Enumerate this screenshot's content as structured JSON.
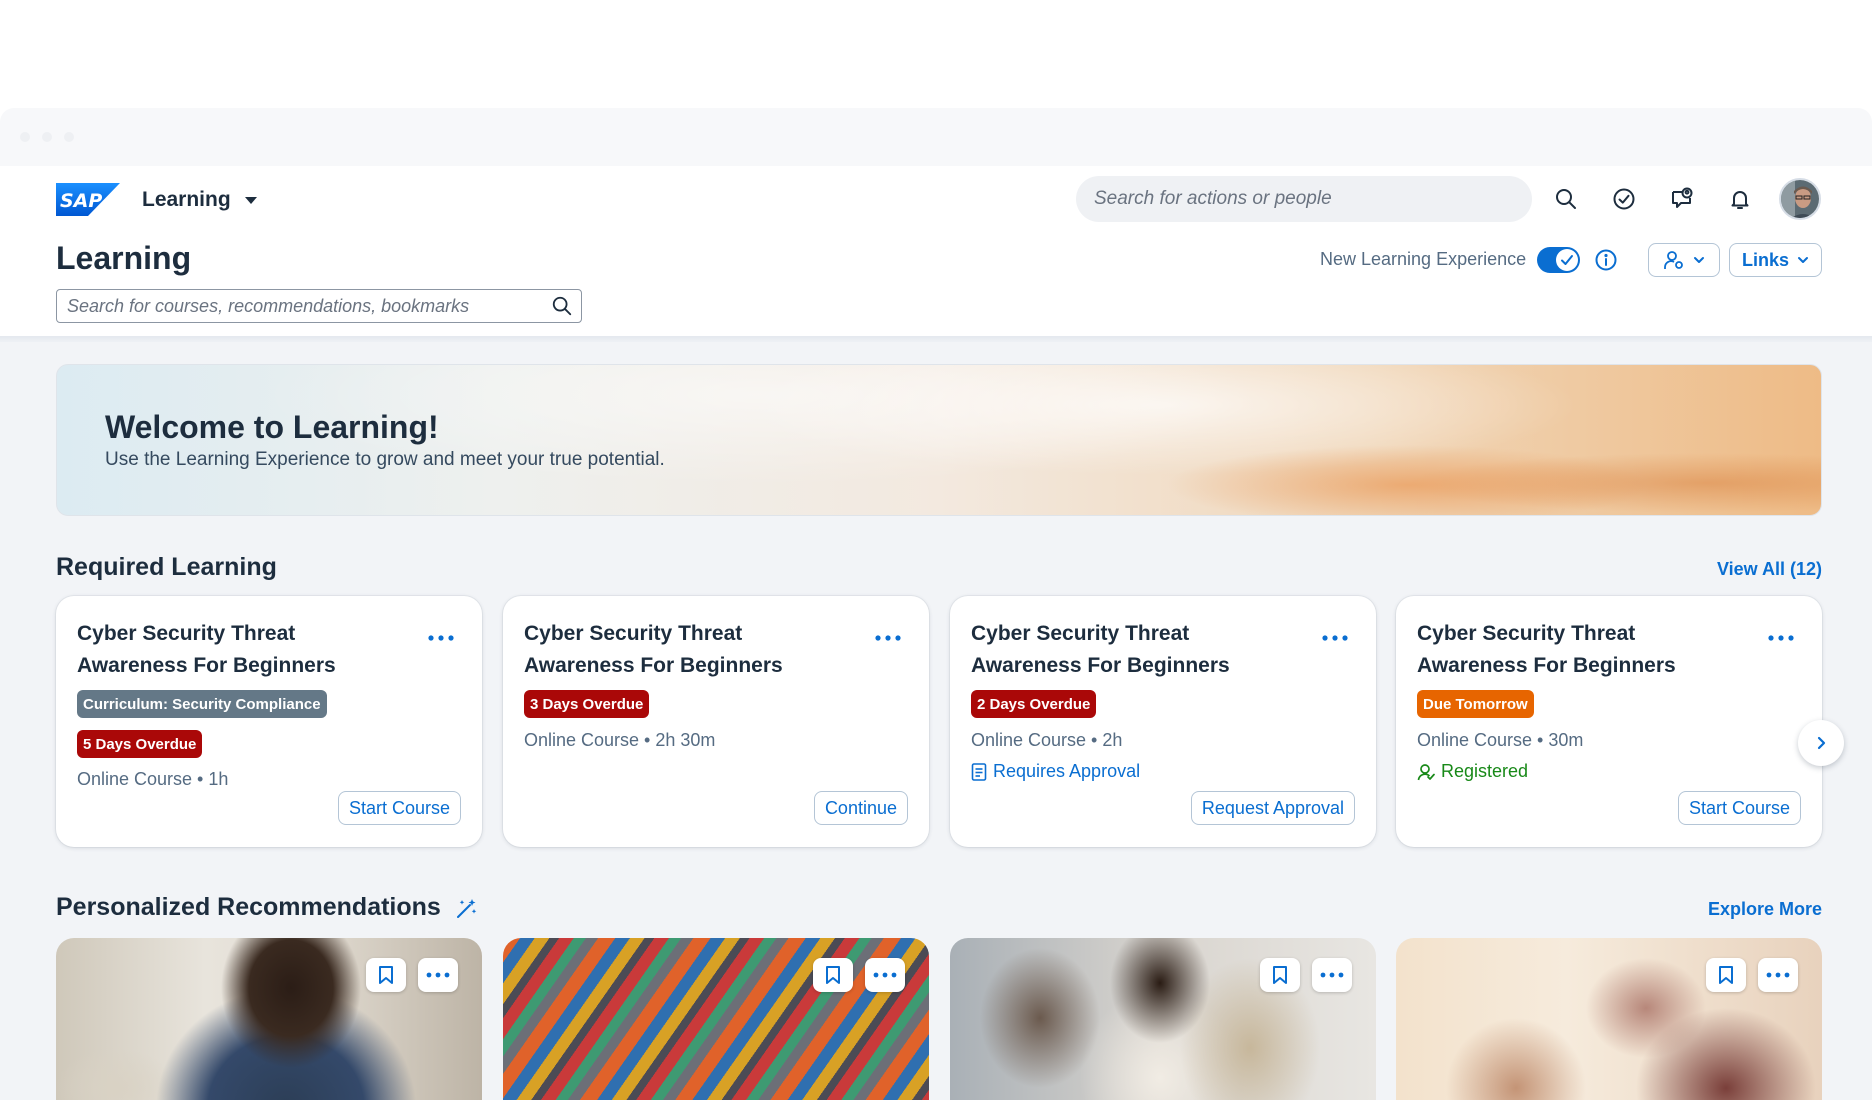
{
  "shell": {
    "logo_text": "SAP",
    "app_name": "Learning",
    "search_placeholder": "Search for actions or people"
  },
  "page": {
    "title": "Learning",
    "search_placeholder": "Search for courses, recommendations, bookmarks",
    "new_experience_label": "New Learning Experience",
    "new_experience_enabled": true,
    "links_label": "Links"
  },
  "banner": {
    "title": "Welcome to Learning!",
    "subtitle": "Use the Learning Experience to grow and meet your true potential."
  },
  "required": {
    "title": "Required Learning",
    "view_all": "View All (12)",
    "cards": [
      {
        "title": "Cyber Security Threat Awareness For Beginners",
        "curriculum_tag": "Curriculum: Security Compliance",
        "due_tag": "5 Days Overdue",
        "meta": "Online Course • 1h",
        "status": "",
        "action": "Start Course"
      },
      {
        "title": "Cyber Security Threat Awareness For Beginners",
        "curriculum_tag": "",
        "due_tag": "3 Days Overdue",
        "meta": "Online Course • 2h 30m",
        "status": "",
        "action": "Continue"
      },
      {
        "title": "Cyber Security Threat Awareness For Beginners",
        "curriculum_tag": "",
        "due_tag": "2 Days Overdue",
        "meta": "Online Course • 2h",
        "status": "Requires Approval",
        "action": "Request Approval"
      },
      {
        "title": "Cyber Security Threat Awareness For Beginners",
        "curriculum_tag": "",
        "due_tag": "Due Tomorrow",
        "meta": "Online Course • 30m",
        "status": "Registered",
        "action": "Start Course"
      }
    ]
  },
  "recommendations": {
    "title": "Personalized Recommendations",
    "explore": "Explore More"
  },
  "colors": {
    "accent": "#0a6ed1",
    "overdue": "#aa0808",
    "due_soon": "#e76500",
    "curriculum": "#647887",
    "registered": "#188918"
  },
  "icons": [
    "search-icon",
    "task-check-icon",
    "chat-icon",
    "bell-icon",
    "info-icon",
    "user-settings-icon",
    "chevron-down-icon",
    "more-icon",
    "chevron-right-icon",
    "bookmark-icon",
    "ai-sparkle-icon",
    "document-icon",
    "user-icon"
  ]
}
